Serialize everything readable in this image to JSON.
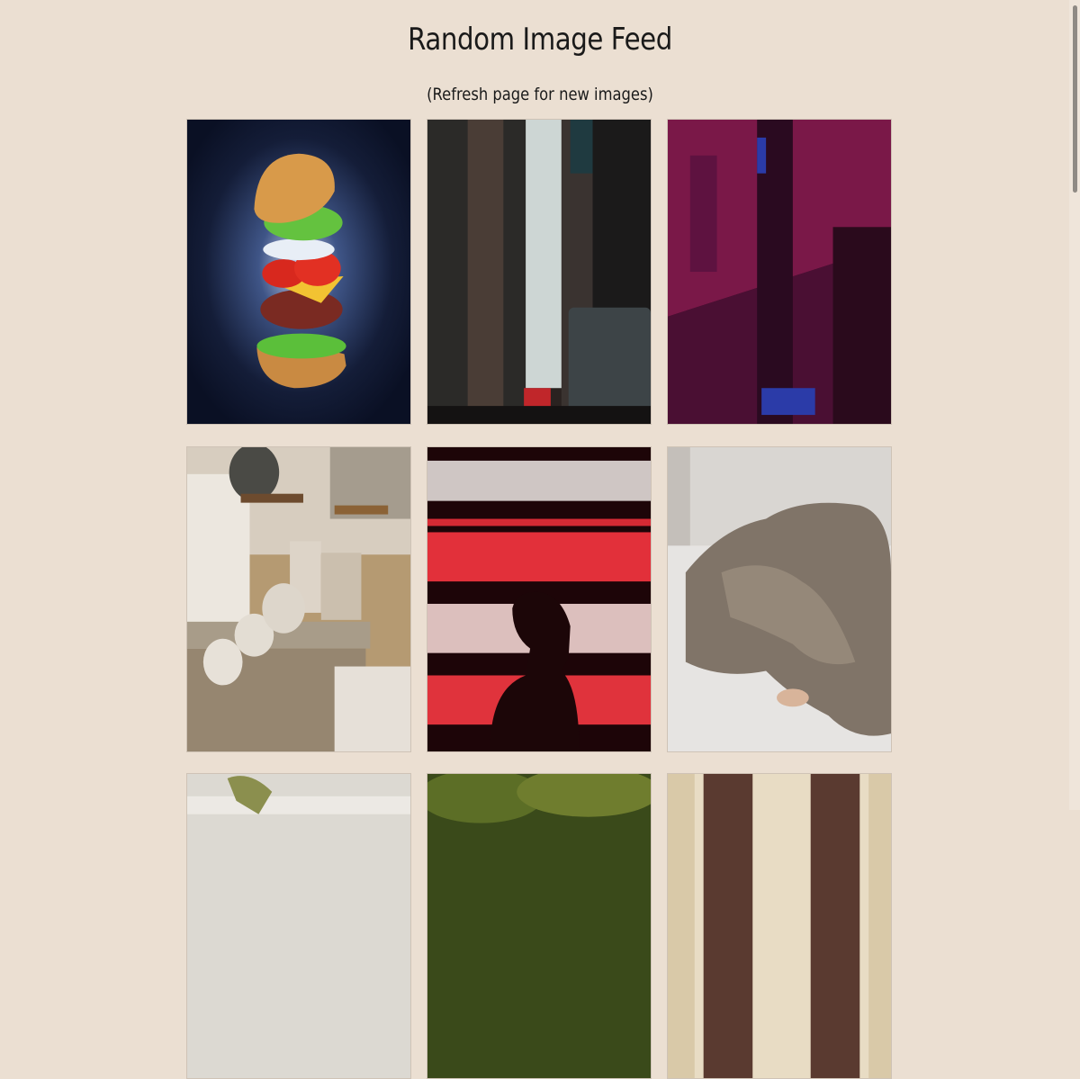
{
  "page": {
    "title": "Random Image Feed",
    "subtitle": "(Refresh page for new images)",
    "background": "#ebdfd2"
  },
  "images": [
    {
      "subject": "floating burger"
    },
    {
      "subject": "city street between skyscrapers"
    },
    {
      "subject": "magenta lit building facade"
    },
    {
      "subject": "rustic interior with pottery"
    },
    {
      "subject": "silhouette against red neon stripes"
    },
    {
      "subject": "rumpled grey bed sheets"
    },
    {
      "subject": "plant on table"
    },
    {
      "subject": "tree canopy"
    },
    {
      "subject": "building with windows"
    }
  ]
}
